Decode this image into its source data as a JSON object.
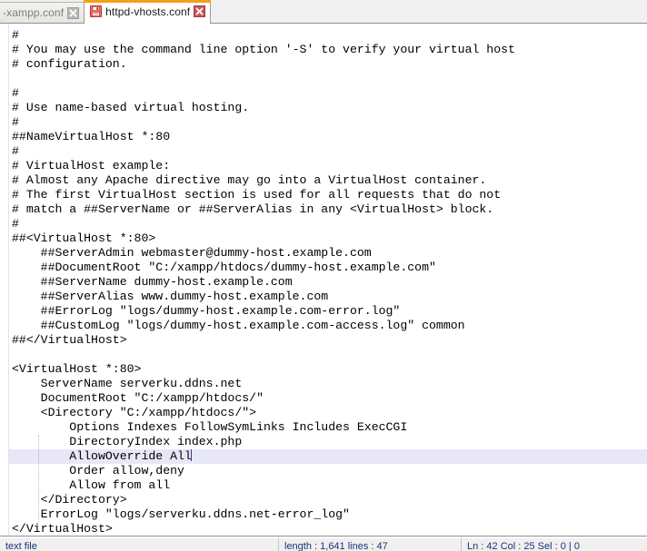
{
  "window": {
    "app": "Notepad++",
    "accent_orange": "#f3a11a",
    "caret_color": "#4b2ea8",
    "current_line_highlight": "#e7e7f7",
    "text_color": "#000000",
    "status_text_color": "#16357a"
  },
  "tabs": [
    {
      "label": "-xampp.conf",
      "active": false,
      "close_icon": "close-icon",
      "save_icon": null
    },
    {
      "label": "httpd-vhosts.conf",
      "active": true,
      "close_icon": "close-icon",
      "save_icon": "save-floppy-icon"
    }
  ],
  "editor": {
    "current_line_index": 29,
    "lines": [
      "#",
      "# You may use the command line option '-S' to verify your virtual host",
      "# configuration.",
      "",
      "#",
      "# Use name-based virtual hosting.",
      "#",
      "##NameVirtualHost *:80",
      "#",
      "# VirtualHost example:",
      "# Almost any Apache directive may go into a VirtualHost container.",
      "# The first VirtualHost section is used for all requests that do not",
      "# match a ##ServerName or ##ServerAlias in any <VirtualHost> block.",
      "#",
      "##<VirtualHost *:80>",
      "    ##ServerAdmin webmaster@dummy-host.example.com",
      "    ##DocumentRoot \"C:/xampp/htdocs/dummy-host.example.com\"",
      "    ##ServerName dummy-host.example.com",
      "    ##ServerAlias www.dummy-host.example.com",
      "    ##ErrorLog \"logs/dummy-host.example.com-error.log\"",
      "    ##CustomLog \"logs/dummy-host.example.com-access.log\" common",
      "##</VirtualHost>",
      "",
      "<VirtualHost *:80>",
      "    ServerName serverku.ddns.net",
      "    DocumentRoot \"C:/xampp/htdocs/\"",
      "    <Directory \"C:/xampp/htdocs/\">",
      "        Options Indexes FollowSymLinks Includes ExecCGI",
      "        DirectoryIndex index.php",
      "        AllowOverride All",
      "        Order allow,deny",
      "        Allow from all",
      "    </Directory>",
      "    ErrorLog \"logs/serverku.ddns.net-error_log\"",
      "</VirtualHost>"
    ]
  },
  "statusbar": {
    "doc_type": "text file",
    "length_lines": "length : 1,641    lines : 47",
    "position": "Ln : 42    Col : 25    Sel : 0 | 0"
  }
}
